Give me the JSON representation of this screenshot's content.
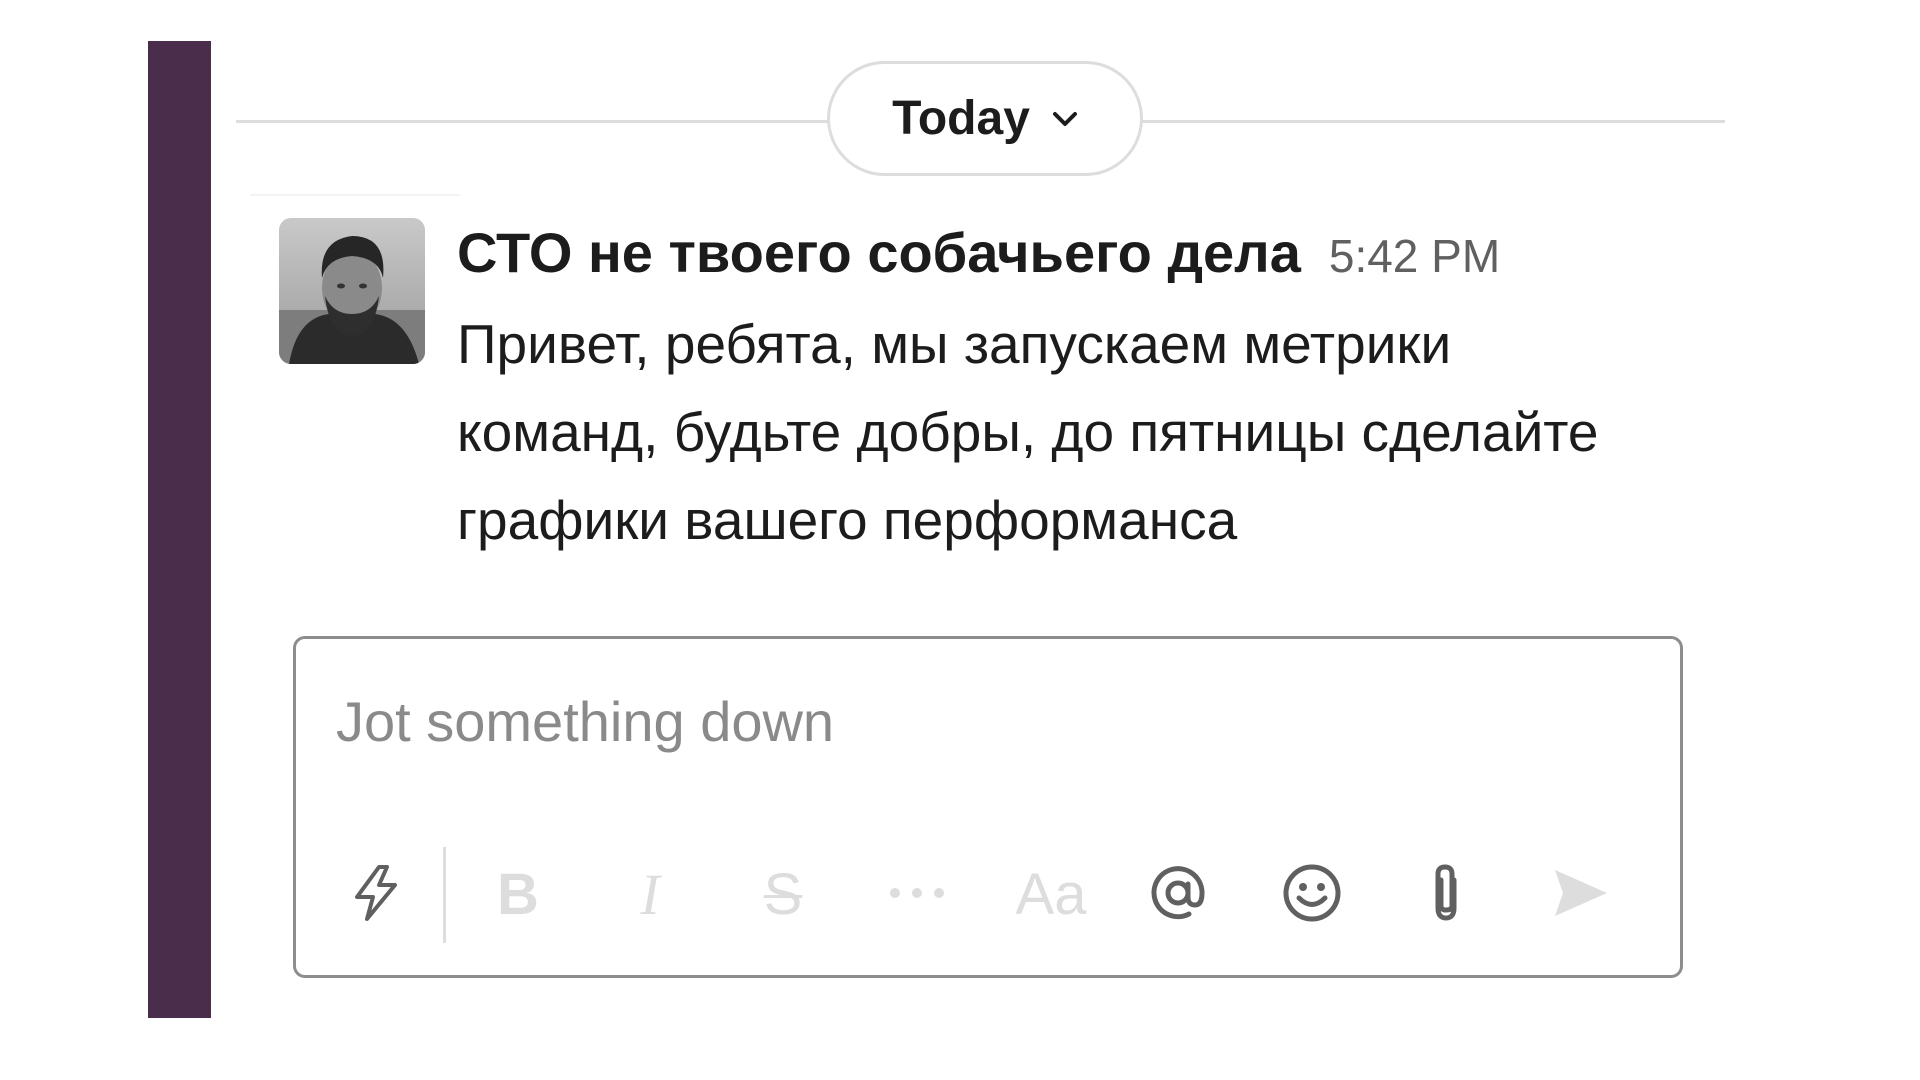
{
  "date_divider": {
    "label": "Today"
  },
  "message": {
    "author": "СТО не твоего собачьего дела",
    "timestamp": "5:42 PM",
    "lines": [
      "Привет, ребята, мы запускаем метрики",
      "команд, будьте добры, до пятницы сделайте",
      "графики вашего перформанса"
    ]
  },
  "composer": {
    "placeholder": "Jot something down",
    "value": "",
    "toolbar": {
      "bold_glyph": "B",
      "italic_glyph": "I",
      "strike_glyph": "S",
      "format_glyph": "Aa"
    }
  },
  "colors": {
    "sidebar": "#4a2d4b",
    "text": "#1d1c1d",
    "timestamp": "#616061",
    "border": "#dddddd",
    "disabled_icon": "#dddddd",
    "active_icon": "#616061"
  },
  "icons": {
    "date_menu": "chevron-down-icon",
    "shortcuts": "lightning-icon",
    "more": "ellipsis-icon",
    "mention": "at-sign-icon",
    "emoji": "smiley-icon",
    "attach": "paperclip-icon",
    "send": "send-icon"
  }
}
